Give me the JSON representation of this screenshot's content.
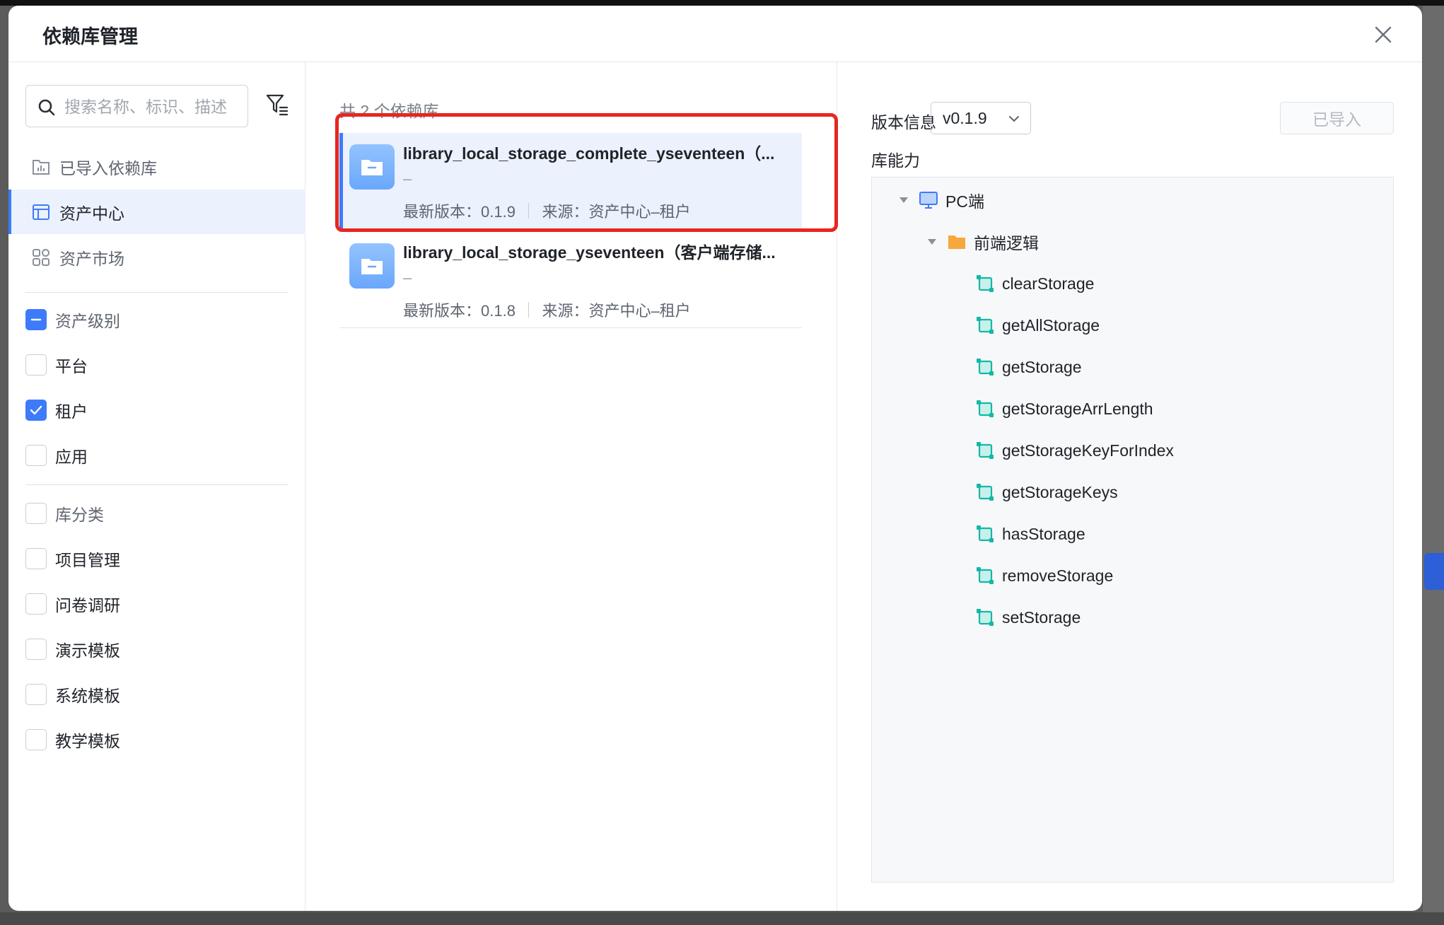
{
  "modal": {
    "title": "依赖库管理"
  },
  "sidebar": {
    "search_placeholder": "搜索名称、标识、描述",
    "nav": [
      {
        "label": "已导入依赖库",
        "icon": "imported-library-icon",
        "active": false
      },
      {
        "label": "资产中心",
        "icon": "asset-center-icon",
        "active": true
      },
      {
        "label": "资产市场",
        "icon": "asset-market-icon",
        "active": false
      }
    ],
    "asset_level": {
      "label": "资产级别",
      "state": "indeterminate",
      "options": [
        {
          "label": "平台",
          "checked": false
        },
        {
          "label": "租户",
          "checked": true
        },
        {
          "label": "应用",
          "checked": false
        }
      ]
    },
    "category": {
      "label": "库分类",
      "state": "unchecked",
      "options": [
        {
          "label": "项目管理",
          "checked": false
        },
        {
          "label": "问卷调研",
          "checked": false
        },
        {
          "label": "演示模板",
          "checked": false
        },
        {
          "label": "系统模板",
          "checked": false
        },
        {
          "label": "教学模板",
          "checked": false
        }
      ]
    }
  },
  "list": {
    "count_text": "共 2 个依赖库",
    "items": [
      {
        "name": "library_local_storage_complete_yseventeen（...",
        "desc": "–",
        "version": "最新版本：0.1.9",
        "source": "来源：资产中心–租户",
        "selected": true
      },
      {
        "name": "library_local_storage_yseventeen（客户端存储...",
        "desc": "–",
        "version": "最新版本：0.1.8",
        "source": "来源：资产中心–租户",
        "selected": false
      }
    ]
  },
  "detail": {
    "version_label": "版本信息",
    "version_value": "v0.1.9",
    "imported_button": "已导入",
    "ability_label": "库能力",
    "tree": {
      "root": "PC端",
      "folder": "前端逻辑",
      "functions": [
        "clearStorage",
        "getAllStorage",
        "getStorage",
        "getStorageArrLength",
        "getStorageKeyForIndex",
        "getStorageKeys",
        "hasStorage",
        "removeStorage",
        "setStorage"
      ]
    }
  },
  "colors": {
    "accent": "#3e7bfa",
    "highlight": "#e8261f",
    "selected_bg": "#ebf1fd",
    "function_icon": "#14b8a6",
    "folder_icon": "#f7a73b"
  }
}
